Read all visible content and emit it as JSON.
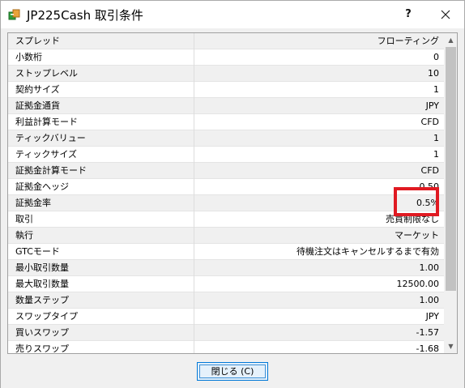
{
  "window": {
    "title": "JP225Cash 取引条件",
    "help_label": "?",
    "close_icon": "close-icon"
  },
  "properties": [
    {
      "label": "スプレッド",
      "value": "フローティング"
    },
    {
      "label": "小数桁",
      "value": "0"
    },
    {
      "label": "ストップレベル",
      "value": "10"
    },
    {
      "label": "契約サイズ",
      "value": "1"
    },
    {
      "label": "証拠金通貨",
      "value": "JPY"
    },
    {
      "label": "利益計算モード",
      "value": "CFD"
    },
    {
      "label": "ティックバリュー",
      "value": "1"
    },
    {
      "label": "ティックサイズ",
      "value": "1"
    },
    {
      "label": "証拠金計算モード",
      "value": "CFD"
    },
    {
      "label": "証拠金ヘッジ",
      "value": "0.50"
    },
    {
      "label": "証拠金率",
      "value": "0.5%"
    },
    {
      "label": "取引",
      "value": "売買制限なし"
    },
    {
      "label": "執行",
      "value": "マーケット"
    },
    {
      "label": "GTCモード",
      "value": "待機注文はキャンセルするまで有効"
    },
    {
      "label": "最小取引数量",
      "value": "1.00"
    },
    {
      "label": "最大取引数量",
      "value": "12500.00"
    },
    {
      "label": "数量ステップ",
      "value": "1.00"
    },
    {
      "label": "スワップタイプ",
      "value": "JPY"
    },
    {
      "label": "買いスワップ",
      "value": "-1.57"
    },
    {
      "label": "売りスワップ",
      "value": "-1.68"
    }
  ],
  "footer": {
    "close_button_label": "閉じる (C)"
  },
  "colors": {
    "highlight": "#e01a22",
    "button_border": "#0078d7"
  }
}
